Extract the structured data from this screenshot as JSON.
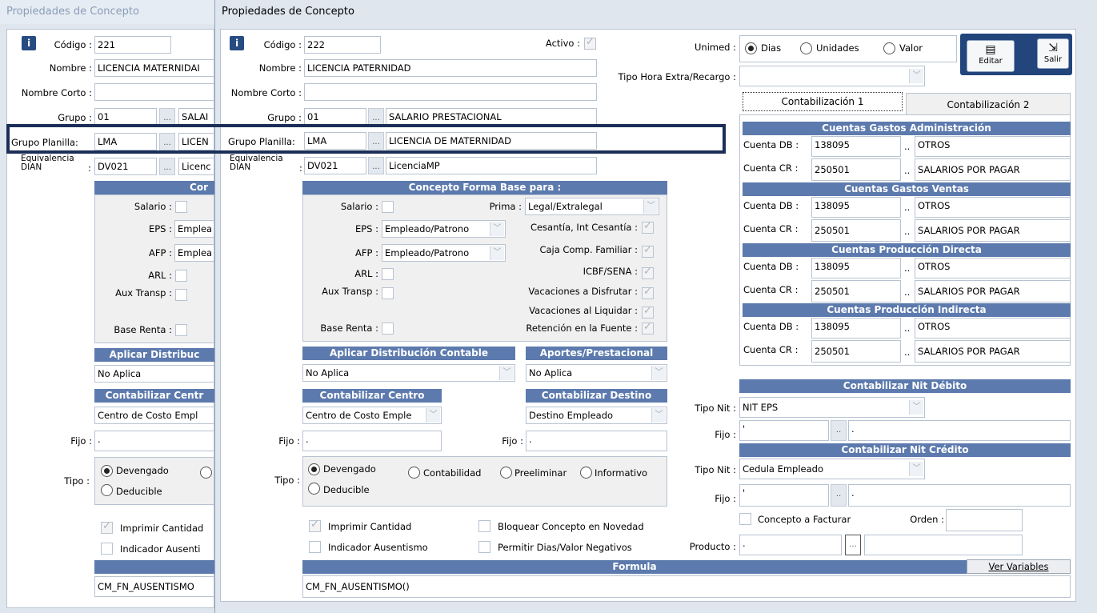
{
  "back_window": {
    "title": "Propiedades de Concepto",
    "codigo_label": "Código :",
    "codigo": "221",
    "nombre_label": "Nombre :",
    "nombre": "LICENCIA MATERNIDAI",
    "nombre_corto_label": "Nombre Corto :",
    "grupo_label": "Grupo :",
    "grupo_code": "01",
    "grupo_name": "SALAI",
    "grupo_planilla_label": "Grupo Planilla:",
    "grupo_planilla_code": "LMA",
    "grupo_planilla_name": "LICEN",
    "equivalencia_label_1": "Equivalencia",
    "equivalencia_label_2": "DIAN",
    "equivalencia_colon": ":",
    "equivalencia_code": "DV021",
    "equivalencia_name": "Licenc",
    "concepto_header": "Cor",
    "salario_label": "Salario :",
    "eps_label": "EPS :",
    "eps_value": "Emplea",
    "afp_label": "AFP :",
    "afp_value": "Emplea",
    "arl_label": "ARL :",
    "aux_label": "Aux Transp :",
    "base_renta_label": "Base Renta :",
    "aplicar_header": "Aplicar Distribuc",
    "aplicar_value": "No Aplica",
    "contab_centro_header": "Contabilizar Centr",
    "contab_centro_value": "Centro de Costo Empl",
    "fijo_label": "Fijo :",
    "fijo_value": ".",
    "tipo_label": "Tipo :",
    "devengado": "Devengado",
    "deducible": "Deducible",
    "imprimir_cantidad": "Imprimir Cantidad",
    "indicador_ausentismo": "Indicador Ausenti",
    "formula": "CM_FN_AUSENTISMO"
  },
  "front_window": {
    "title": "Propiedades de Concepto",
    "codigo_label": "Código :",
    "codigo": "222",
    "activo_label": "Activo :",
    "nombre_label": "Nombre :",
    "nombre": "LICENCIA PATERNIDAD",
    "nombre_corto_label": "Nombre Corto :",
    "nombre_corto": "",
    "grupo_label": "Grupo :",
    "grupo_code": "01",
    "grupo_name": "SALARIO PRESTACIONAL",
    "grupo_planilla_label": "Grupo Planilla:",
    "grupo_planilla_code": "LMA",
    "grupo_planilla_name": "LICENCIA DE MATERNIDAD",
    "equivalencia_label_1": "Equivalencia",
    "equivalencia_label_2": "DIAN",
    "equivalencia_colon": ":",
    "equivalencia_code": "DV021",
    "equivalencia_name": "LicenciaMP",
    "ellipsis": "...",
    "concepto_forma_header": "Concepto Forma Base para :",
    "salario_label": "Salario :",
    "prima_label": "Prima :",
    "prima_value": "Legal/Extralegal",
    "eps_label": "EPS :",
    "eps_value": "Empleado/Patrono",
    "cesantia_label": "Cesantía, Int Cesantía :",
    "afp_label": "AFP :",
    "afp_value": "Empleado/Patrono",
    "caja_label": "Caja Comp. Familiar :",
    "arl_label": "ARL :",
    "icbf_label": "ICBF/SENA :",
    "aux_label": "Aux Transp :",
    "vac_disfrutar_label": "Vacaciones a Disfrutar :",
    "vac_liquidar_label": "Vacaciones al Liquidar :",
    "base_renta_label": "Base Renta :",
    "retencion_label": "Retención en la Fuente :",
    "aplicar_header": "Aplicar Distribución Contable",
    "aplicar_value": "No Aplica",
    "aportes_header": "Aportes/Prestacional",
    "aportes_value": "No Aplica",
    "contab_centro_header": "Contabilizar Centro",
    "contab_centro_value": "Centro de Costo Emple",
    "contab_destino_header": "Contabilizar Destino",
    "contab_destino_value": "Destino Empleado",
    "fijo_label": "Fijo :",
    "fijo_value": ".",
    "fijo2_label": "Fijo :",
    "fijo2_value": ".",
    "tipo_label": "Tipo :",
    "devengado": "Devengado",
    "contabilidad": "Contabilidad",
    "preeliminar": "Preeliminar",
    "informativo": "Informativo",
    "deducible": "Deducible",
    "imprimir_cantidad": "Imprimir Cantidad",
    "bloquear_concepto": "Bloquear Concepto en Novedad",
    "indicador_ausentismo": "Indicador Ausentismo",
    "permitir_dias": "Permitir Dias/Valor Negativos",
    "formula_header": "Formula",
    "ver_variables": "Ver Variables",
    "formula": "CM_FN_AUSENTISMO()",
    "unimed_label": "Unimed :",
    "unimed_dias": "Dias",
    "unimed_unidades": "Unidades",
    "unimed_valor": "Valor",
    "tipo_hora_label": "Tipo Hora Extra/Recargo :",
    "editar": "Editar",
    "salir": "Salir",
    "tab1": "Contabilización 1",
    "tab2": "Contabilización 2",
    "cuentas": [
      {
        "header": "Cuentas Gastos Administración",
        "db_label": "Cuenta DB :",
        "db_code": "138095",
        "db_name": "OTROS",
        "cr_label": "Cuenta CR :",
        "cr_code": "250501",
        "cr_name": "SALARIOS POR PAGAR"
      },
      {
        "header": "Cuentas Gastos Ventas",
        "db_label": "Cuenta DB :",
        "db_code": "138095",
        "db_name": "OTROS",
        "cr_label": "Cuenta CR :",
        "cr_code": "250501",
        "cr_name": "SALARIOS POR PAGAR"
      },
      {
        "header": "Cuentas Producción Directa",
        "db_label": "Cuenta DB :",
        "db_code": "138095",
        "db_name": "OTROS",
        "cr_label": "Cuenta CR :",
        "cr_code": "250501",
        "cr_name": "SALARIOS POR PAGAR"
      },
      {
        "header": "Cuentas Producción Indirecta",
        "db_label": "Cuenta DB :",
        "db_code": "138095",
        "db_name": "OTROS",
        "cr_label": "Cuenta CR :",
        "cr_code": "250501",
        "cr_name": "SALARIOS POR PAGAR"
      }
    ],
    "dots": "..",
    "nit_debito_header": "Contabilizar Nit Débito",
    "tipo_nit_label": "Tipo Nit :",
    "tipo_nit_debito": "NIT EPS",
    "nit_fijo_label": "Fijo :",
    "nit_fijo_debito_a": "'",
    "nit_fijo_debito_b": ".",
    "nit_credito_header": "Contabilizar Nit Crédito",
    "tipo_nit_credito": "Cedula Empleado",
    "nit_fijo_credito_a": "'",
    "nit_fijo_credito_b": ".",
    "concepto_facturar": "Concepto a Facturar",
    "orden_label": "Orden :",
    "orden_value": "",
    "producto_label": "Producto :",
    "producto_value": ".",
    "producto_ellipsis": "..."
  }
}
